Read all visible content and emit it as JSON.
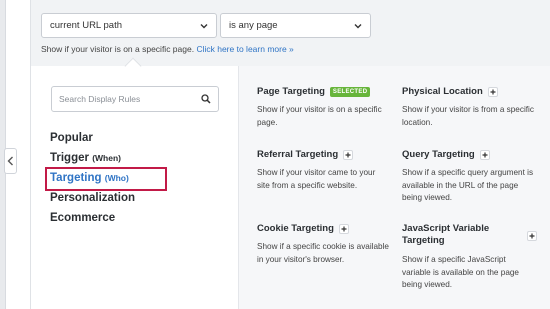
{
  "top": {
    "url_select": "current URL path",
    "page_select": "is any page",
    "hint_text": "Show if your visitor is on a specific page.",
    "hint_link": "Click here to learn more »"
  },
  "sidebar": {
    "search_placeholder": "Search Display Rules",
    "categories": [
      {
        "label": "Popular",
        "sub": ""
      },
      {
        "label": "Trigger",
        "sub": "(When)"
      },
      {
        "label": "Targeting",
        "sub": "(Who)"
      },
      {
        "label": "Personalization",
        "sub": ""
      },
      {
        "label": "Ecommerce",
        "sub": ""
      }
    ]
  },
  "rules": [
    {
      "title": "Page Targeting",
      "badge": "SELECTED",
      "desc": "Show if your visitor is on a specific page."
    },
    {
      "title": "Physical Location",
      "desc": "Show if your visitor is from a specific location."
    },
    {
      "title": "Referral Targeting",
      "desc": "Show if your visitor came to your site from a specific website."
    },
    {
      "title": "Query Targeting",
      "desc": "Show if a specific query argument is available in the URL of the page being viewed."
    },
    {
      "title": "Cookie Targeting",
      "desc": "Show if a specific cookie is available in your visitor's browser."
    },
    {
      "title": "JavaScript Variable Targeting",
      "desc": "Show if a specific JavaScript variable is available on the page being viewed."
    }
  ],
  "colors": {
    "accent": "#2f74c5",
    "highlight": "#c21a47",
    "badge": "#67b53b"
  },
  "icons": [
    "chevron-left-icon",
    "chevron-down-icon",
    "search-icon",
    "plus-icon"
  ]
}
